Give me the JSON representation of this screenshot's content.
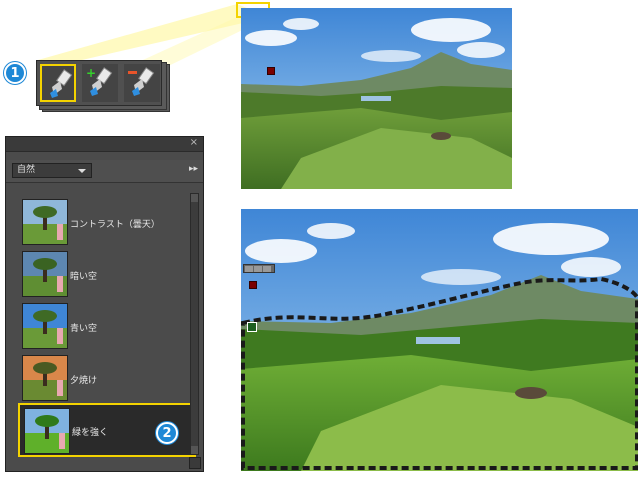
{
  "badges": {
    "step1": "1",
    "step2": "2"
  },
  "toolbar": {
    "tools": [
      {
        "name": "adjustment-brush-icon",
        "active": true
      },
      {
        "name": "add-to-selection-icon",
        "modifier": "+"
      },
      {
        "name": "subtract-from-selection-icon",
        "modifier": "−"
      }
    ]
  },
  "panel": {
    "close": "×",
    "dropdown_value": "自然",
    "menu_glyph": "▸▸",
    "presets": [
      {
        "label": "コントラスト（曇天）",
        "tone": "cloudy"
      },
      {
        "label": "暗い空",
        "tone": "dark"
      },
      {
        "label": "青い空",
        "tone": "blue"
      },
      {
        "label": "夕焼け",
        "tone": "sunset"
      },
      {
        "label": "緑を強く",
        "tone": "green",
        "selected": true
      }
    ]
  },
  "colors": {
    "highlight": "#f4d300",
    "badge": "#1e88d6",
    "panel": "#4b4b4b"
  }
}
